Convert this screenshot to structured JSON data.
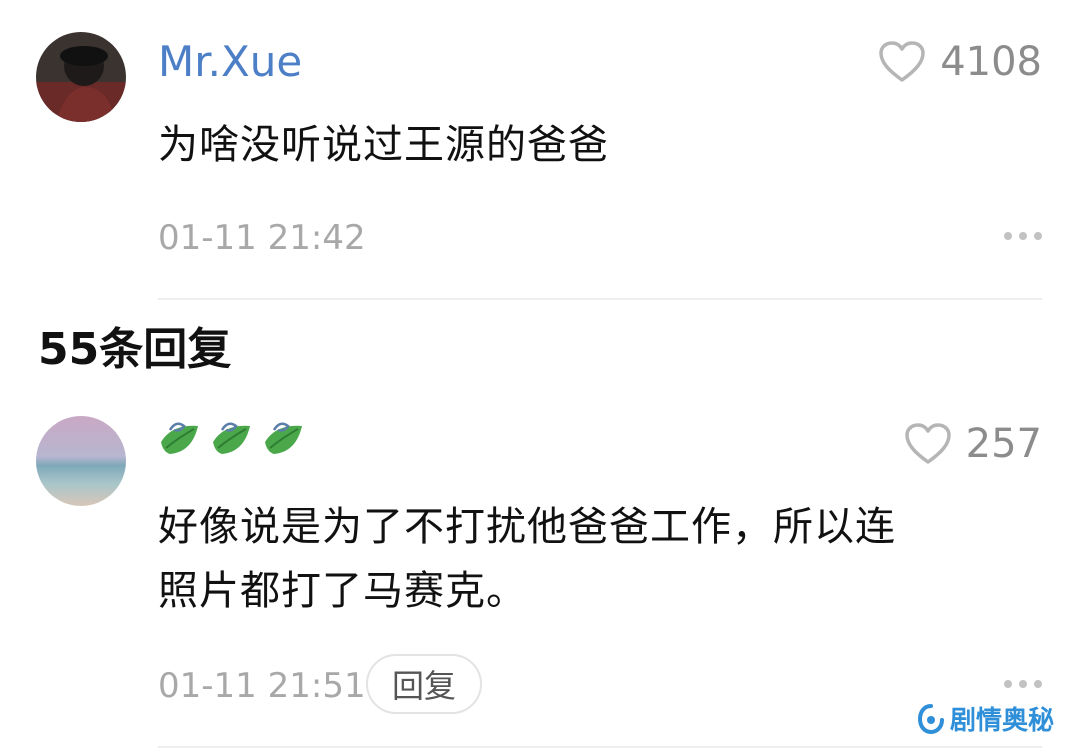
{
  "top_comment": {
    "username": "Mr.Xue",
    "likes": "4108",
    "text": "为啥没听说过王源的爸爸",
    "timestamp": "01-11 21:42"
  },
  "replies_header": "55条回复",
  "reply": {
    "likes": "257",
    "text_line1": "好像说是为了不打扰他爸爸工作，所以连",
    "text_line2": "照片都打了马赛克。",
    "timestamp": "01-11 21:51",
    "reply_button": "回复"
  },
  "watermark": "剧情奥秘",
  "icons": {
    "like": "heart-outline-icon",
    "more": "more-dots-icon",
    "username_leaf": "leaf-icon",
    "watermark": "logo-icon"
  },
  "colors": {
    "username": "#4d7fc7",
    "secondary_text": "#a8a8a8",
    "watermark": "#2f8fd8"
  }
}
